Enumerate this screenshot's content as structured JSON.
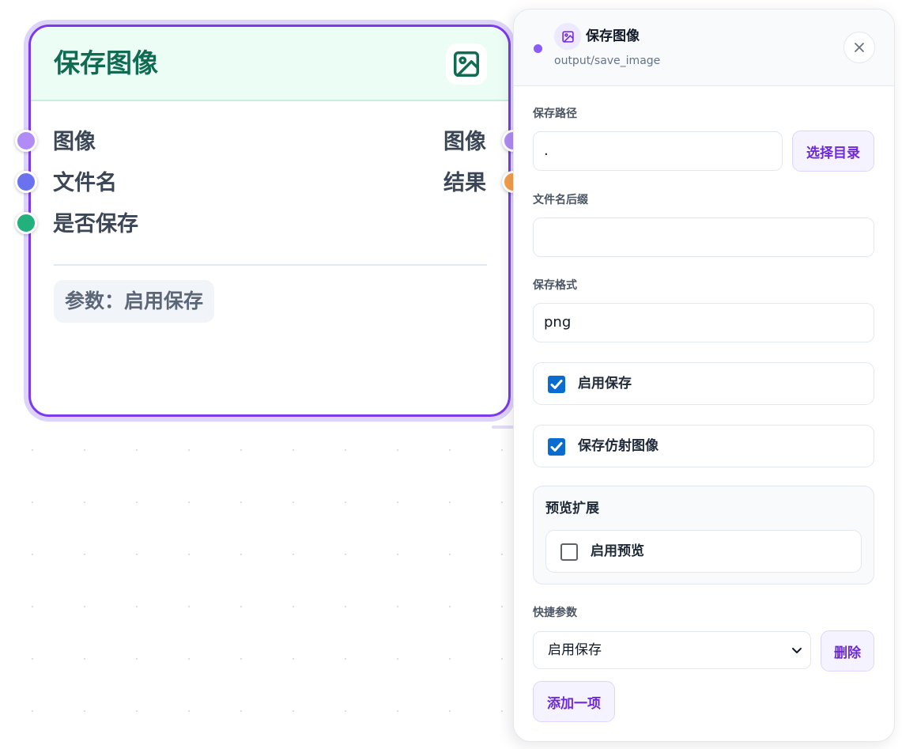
{
  "node": {
    "title": "保存图像",
    "icon": "image-icon",
    "inputs": [
      {
        "label": "图像",
        "color": "#b18cf5"
      },
      {
        "label": "文件名",
        "color": "#6b72f0"
      },
      {
        "label": "是否保存",
        "color": "#22b07d"
      }
    ],
    "outputs": [
      {
        "label": "图像",
        "color": "#b18cf5"
      },
      {
        "label": "结果",
        "color": "#f59e4c"
      }
    ],
    "param_chip": "参数：启用保存"
  },
  "panel": {
    "title": "保存图像",
    "subtitle": "output/save_image",
    "close_icon": "close-icon",
    "fields": {
      "save_path": {
        "label": "保存路径",
        "value": ".",
        "browse_button": "选择目录"
      },
      "filename_suffix": {
        "label": "文件名后缀",
        "value": ""
      },
      "save_format": {
        "label": "保存格式",
        "value": "png"
      }
    },
    "checkboxes": {
      "enable_save": {
        "label": "启用保存",
        "checked": true
      },
      "save_affine": {
        "label": "保存仿射图像",
        "checked": true
      }
    },
    "preview_group": {
      "title": "预览扩展",
      "enable_preview": {
        "label": "启用预览",
        "checked": false
      }
    },
    "quick_params": {
      "label": "快捷参数",
      "selected": "启用保存",
      "delete_button": "删除",
      "add_button": "添加一项"
    }
  },
  "colors": {
    "accent": "#7c3aed",
    "header_green": "#0f6b52",
    "checkbox_blue": "#0a6bd1"
  }
}
